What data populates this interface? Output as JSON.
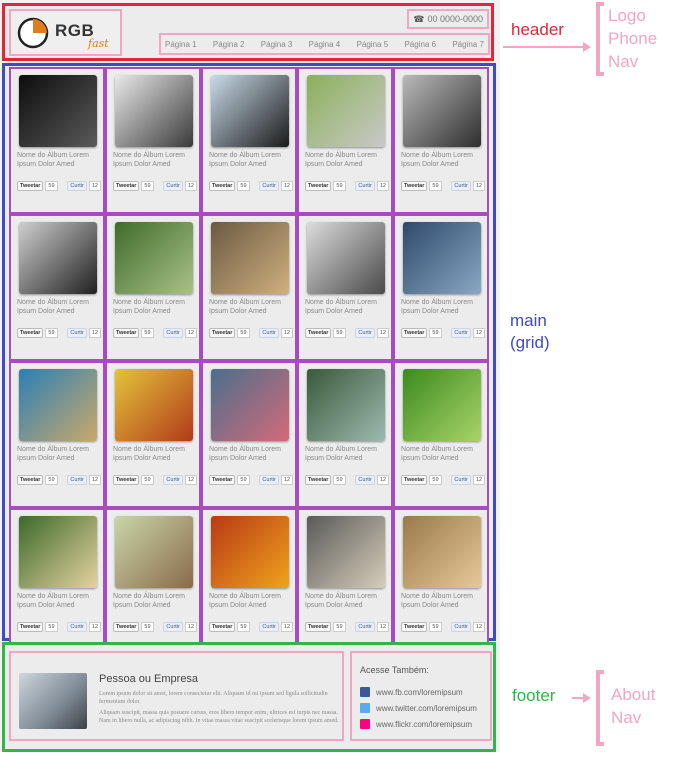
{
  "header": {
    "logo": {
      "text": "RGB",
      "sub": "fast"
    },
    "phone": "00 0000-0000",
    "nav": [
      "Página 1",
      "Página 2",
      "Página 3",
      "Página 4",
      "Página 5",
      "Página 6",
      "Página 7"
    ]
  },
  "grid": {
    "card_title": "Nome do Álbum Lorem Ipsum Dolor Amed",
    "tweet_label": "Tweetar",
    "tweet_count": "59",
    "like_label": "Curtir",
    "like_count": "12",
    "thumbs": [
      [
        "#0d0d0d",
        "#5a5a5a"
      ],
      [
        "#e9e9e9",
        "#3a3a3a"
      ],
      [
        "#c9dbe9",
        "#1b1b1b"
      ],
      [
        "#8bb05a",
        "#c9c9c9"
      ],
      [
        "#b9b9b9",
        "#2e2e2e"
      ],
      [
        "#cfcfcf",
        "#202020"
      ],
      [
        "#3f6d2a",
        "#a9c08a"
      ],
      [
        "#6b5a42",
        "#d0b080"
      ],
      [
        "#dcdcdc",
        "#4a4a4a"
      ],
      [
        "#2d4a6b",
        "#8aa7c4"
      ],
      [
        "#2b7fb6",
        "#c9a96a"
      ],
      [
        "#e2c43a",
        "#b23a1a"
      ],
      [
        "#4a6f8c",
        "#d46a7a"
      ],
      [
        "#3a5a3a",
        "#9bbab0"
      ],
      [
        "#3c8a1e",
        "#a8d46a"
      ],
      [
        "#3c6a2a",
        "#e6d2a0"
      ],
      [
        "#c9d6a8",
        "#8a6a4a"
      ],
      [
        "#b83a14",
        "#f0a21e"
      ],
      [
        "#5a5a5a",
        "#d6cdb9"
      ],
      [
        "#9a7a4a",
        "#e6c89a"
      ]
    ]
  },
  "footer": {
    "about_title": "Pessoa ou Empresa",
    "about_p1": "Lorem ipsum dolor sit amet, lorem consectetur elit. Aliquam id mi ipsum sed ligula sollicitudin fermentum dolor.",
    "about_p2": "Aliquam suscipit, massa quis posuere cursus, eros libero tempor enim, ultrices est turpis nec massa. Nam in libero nulla, ac adipiscing nibh. In vitae massa vitae suscipit scelerisque lorem ipsum amed.",
    "links_title": "Acesse Também:",
    "links": [
      "www.fb.com/loremipsum",
      "www.twitter.com/loremipsum",
      "www.flickr.com/loremipsum"
    ],
    "link_colors": [
      "#3b5998",
      "#55acee",
      "#ff0084"
    ]
  },
  "annotations": {
    "header_label": "header",
    "header_items": [
      "Logo",
      "Phone",
      "Nav"
    ],
    "main_label_1": "main",
    "main_label_2": "(grid)",
    "footer_label": "footer",
    "footer_items": [
      "About",
      "Nav"
    ]
  },
  "colors": {
    "header": "#e32636",
    "main": "#3f4bc4",
    "footer": "#2fb84a",
    "card_border": "#a64dbd",
    "callout": "#f2a6c3"
  }
}
